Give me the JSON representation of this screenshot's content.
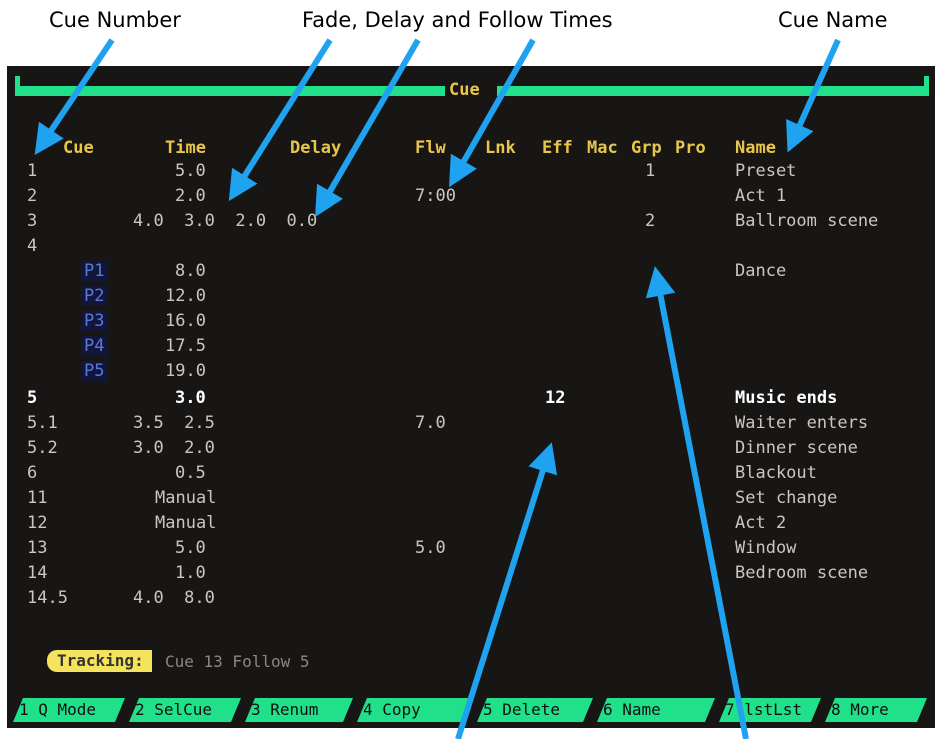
{
  "callouts": {
    "cue_number": "Cue Number",
    "times": "Fade, Delay and Follow Times",
    "cue_name": "Cue Name"
  },
  "screen": {
    "title": "Cue",
    "headers": {
      "cue": "Cue",
      "time": "Time",
      "delay": "Delay",
      "flw": "Flw",
      "lnk": "Lnk",
      "eff": "Eff",
      "mac": "Mac",
      "grp": "Grp",
      "pro": "Pro",
      "name": "Name"
    },
    "rows": [
      {
        "cue": "1",
        "time": "5.0",
        "flw": "",
        "eff": "",
        "grp": "1",
        "name": "Preset"
      },
      {
        "cue": "2",
        "time": "2.0",
        "flw": "7:00",
        "eff": "",
        "grp": "",
        "name": "Act 1"
      },
      {
        "cue": "3",
        "time": "4.0  3.0  2.0  0.0",
        "flw": "",
        "eff": "",
        "grp": "2",
        "name": "Ballroom scene"
      },
      {
        "cue": "4",
        "time": "",
        "flw": "",
        "eff": "",
        "grp": "",
        "name": ""
      },
      {
        "cue": "P1",
        "time": "8.0",
        "flw": "",
        "eff": "",
        "grp": "",
        "name": "Dance"
      },
      {
        "cue": "P2",
        "time": "12.0",
        "flw": "",
        "eff": "",
        "grp": "",
        "name": ""
      },
      {
        "cue": "P3",
        "time": "16.0",
        "flw": "",
        "eff": "",
        "grp": "",
        "name": ""
      },
      {
        "cue": "P4",
        "time": "17.5",
        "flw": "",
        "eff": "",
        "grp": "",
        "name": ""
      },
      {
        "cue": "P5",
        "time": "19.0",
        "flw": "",
        "eff": "",
        "grp": "",
        "name": ""
      },
      {
        "cue": "5",
        "time": "3.0",
        "flw": "",
        "eff": "12",
        "grp": "",
        "name": "Music ends"
      },
      {
        "cue": "5.1",
        "time": "3.5  2.5",
        "flw": "7.0",
        "eff": "",
        "grp": "",
        "name": "Waiter enters"
      },
      {
        "cue": "5.2",
        "time": "3.0  2.0",
        "flw": "",
        "eff": "",
        "grp": "",
        "name": "Dinner scene"
      },
      {
        "cue": "6",
        "time": "0.5",
        "flw": "",
        "eff": "",
        "grp": "",
        "name": "Blackout"
      },
      {
        "cue": "11",
        "time": "Manual",
        "flw": "",
        "eff": "",
        "grp": "",
        "name": "Set change"
      },
      {
        "cue": "12",
        "time": "Manual",
        "flw": "",
        "eff": "",
        "grp": "",
        "name": "Act 2"
      },
      {
        "cue": "13",
        "time": "5.0",
        "flw": "5.0",
        "eff": "",
        "grp": "",
        "name": "Window"
      },
      {
        "cue": "14",
        "time": "1.0",
        "flw": "",
        "eff": "",
        "grp": "",
        "name": "Bedroom scene"
      },
      {
        "cue": "14.5",
        "time": "4.0  8.0",
        "flw": "",
        "eff": "",
        "grp": "",
        "name": ""
      }
    ],
    "tracking_label": "Tracking:",
    "tracking_value": "Cue 13 Follow 5",
    "softkeys": [
      "1 Q Mode",
      "2 SelCue",
      "3 Renum",
      "4 Copy",
      "5 Delete",
      "6 Name",
      "7 lstLst",
      "8 More"
    ]
  },
  "colors": {
    "accent": "#21e08a",
    "header": "#e8c64a",
    "arrow": "#1fa2f0",
    "part": "#5a7ad8",
    "background": "#181614"
  }
}
